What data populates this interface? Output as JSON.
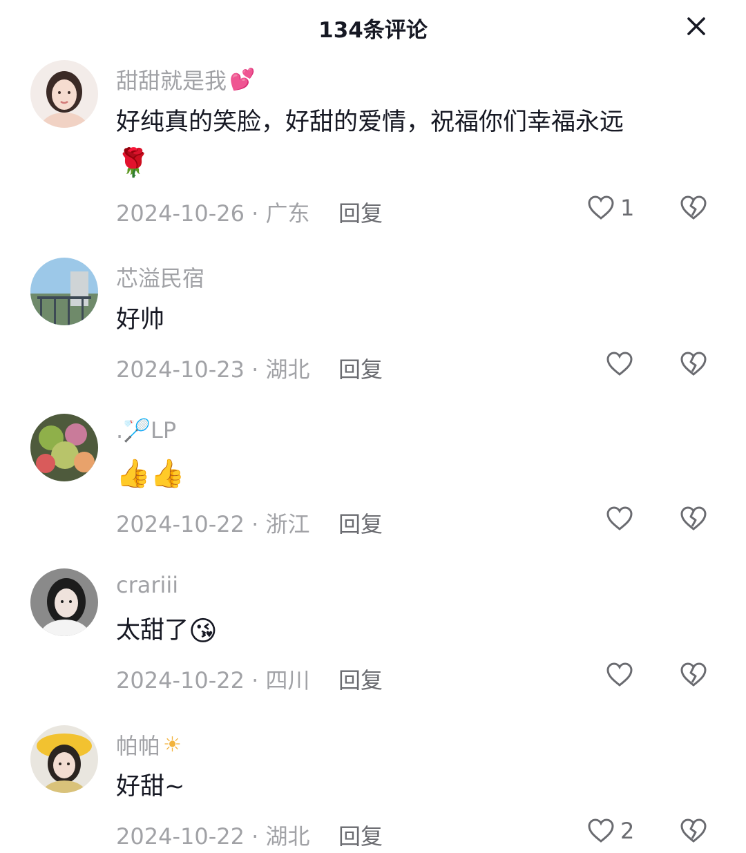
{
  "header": {
    "title": "134条评论"
  },
  "comments": [
    {
      "username": "甜甜就是我",
      "name_deco": "💕",
      "text": "好纯真的笑脸，好甜的爱情，祝福你们幸福永远",
      "emoji": "🌹",
      "date_location": "2024-10-26 · 广东",
      "reply_label": "回复",
      "likes": "1"
    },
    {
      "username": "芯溢民宿",
      "name_deco": "",
      "text": "好帅",
      "emoji": "",
      "date_location": "2024-10-23 · 湖北",
      "reply_label": "回复",
      "likes": ""
    },
    {
      "username": ".🏸LP",
      "name_deco": "",
      "text": "",
      "emoji": "👍👍",
      "date_location": "2024-10-22 · 浙江",
      "reply_label": "回复",
      "likes": ""
    },
    {
      "username": "crariii",
      "name_deco": "",
      "text": "太甜了",
      "emoji": "😘",
      "date_location": "2024-10-22 · 四川",
      "reply_label": "回复",
      "likes": ""
    },
    {
      "username": "帕帕",
      "name_deco": "☀",
      "text": "好甜~",
      "emoji": "",
      "date_location": "2024-10-22 · 湖北",
      "reply_label": "回复",
      "likes": "2"
    }
  ],
  "icons": {
    "close": "close-icon",
    "like": "heart-outline-icon",
    "dislike": "broken-heart-icon"
  },
  "colors": {
    "primary_text": "#161823",
    "secondary_text": "#a1a2a6",
    "icon": "#6a6b70"
  }
}
